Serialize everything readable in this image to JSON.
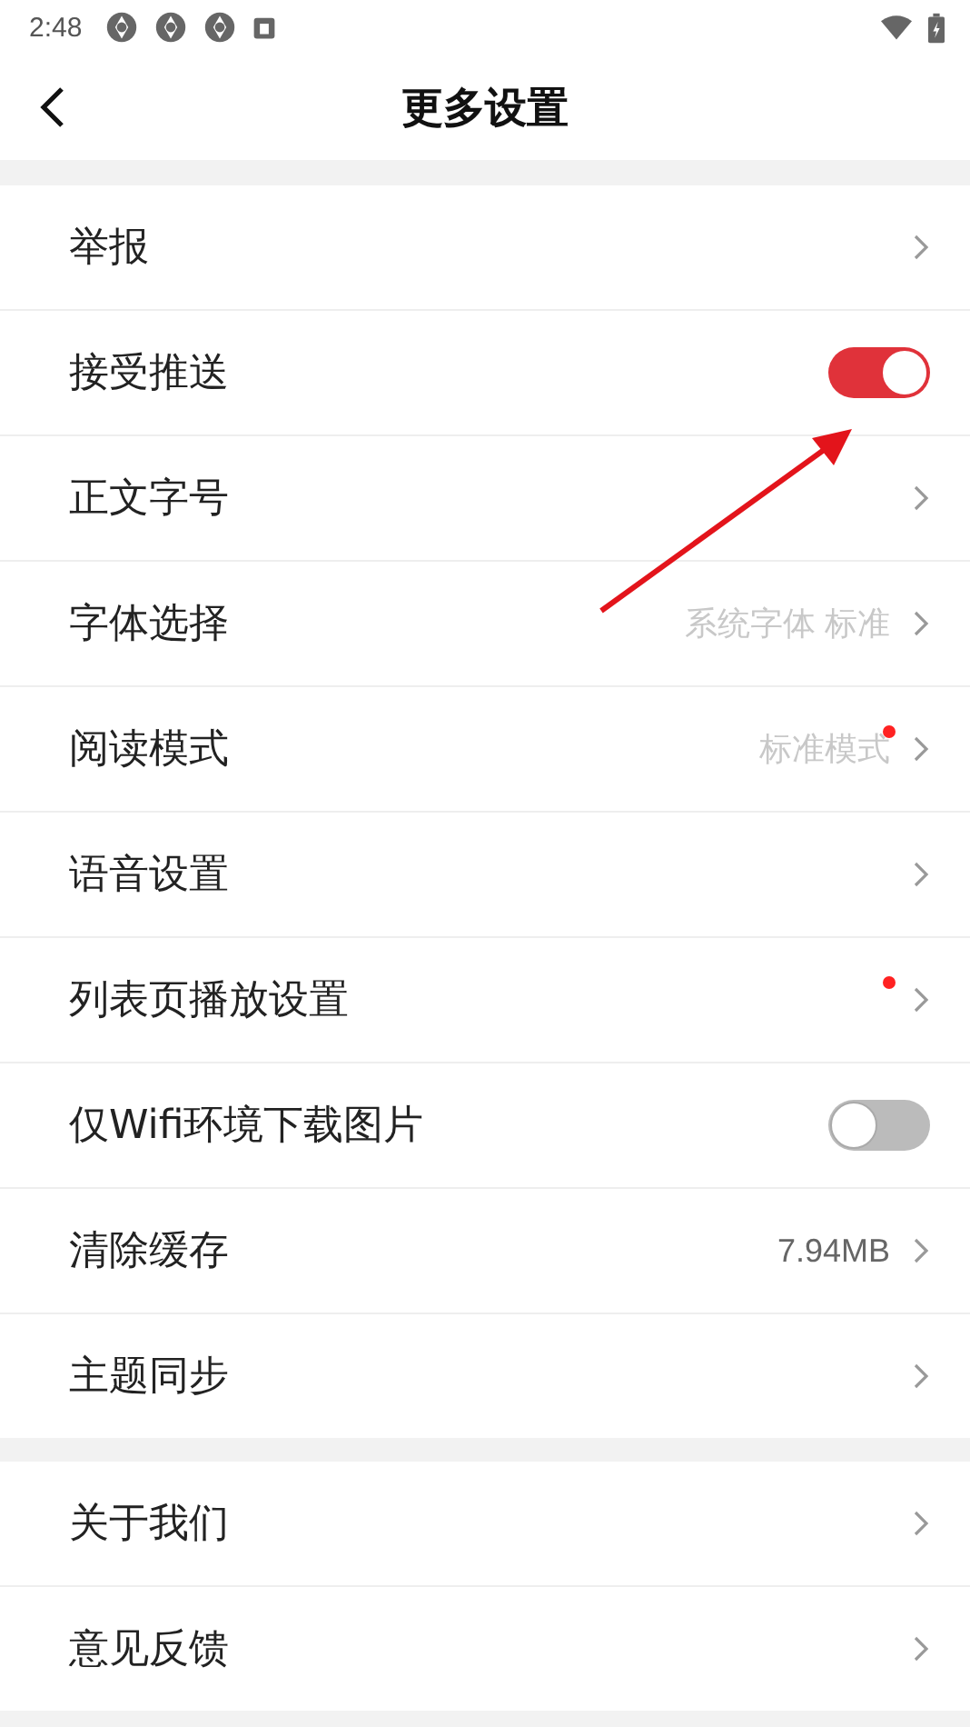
{
  "status_bar": {
    "time": "2:48"
  },
  "header": {
    "title": "更多设置"
  },
  "groups": [
    {
      "rows": [
        {
          "kind": "link",
          "label": "举报",
          "badge": false
        },
        {
          "kind": "toggle",
          "label": "接受推送",
          "on": true
        },
        {
          "kind": "link",
          "label": "正文字号",
          "badge": false
        },
        {
          "kind": "link",
          "label": "字体选择",
          "value": "系统字体 标准",
          "dimmed": true,
          "badge": false
        },
        {
          "kind": "link",
          "label": "阅读模式",
          "value": "标准模式",
          "dimmed": true,
          "badge": true
        },
        {
          "kind": "link",
          "label": "语音设置",
          "badge": false
        },
        {
          "kind": "link",
          "label": "列表页播放设置",
          "badge": true
        },
        {
          "kind": "toggle",
          "label": "仅Wifi环境下载图片",
          "on": false
        },
        {
          "kind": "link",
          "label": "清除缓存",
          "value": "7.94MB",
          "dimmed": false,
          "badge": false
        },
        {
          "kind": "link",
          "label": "主题同步",
          "badge": false
        }
      ]
    },
    {
      "rows": [
        {
          "kind": "link",
          "label": "关于我们",
          "badge": false
        },
        {
          "kind": "link",
          "label": "意见反馈",
          "badge": false
        }
      ]
    }
  ]
}
